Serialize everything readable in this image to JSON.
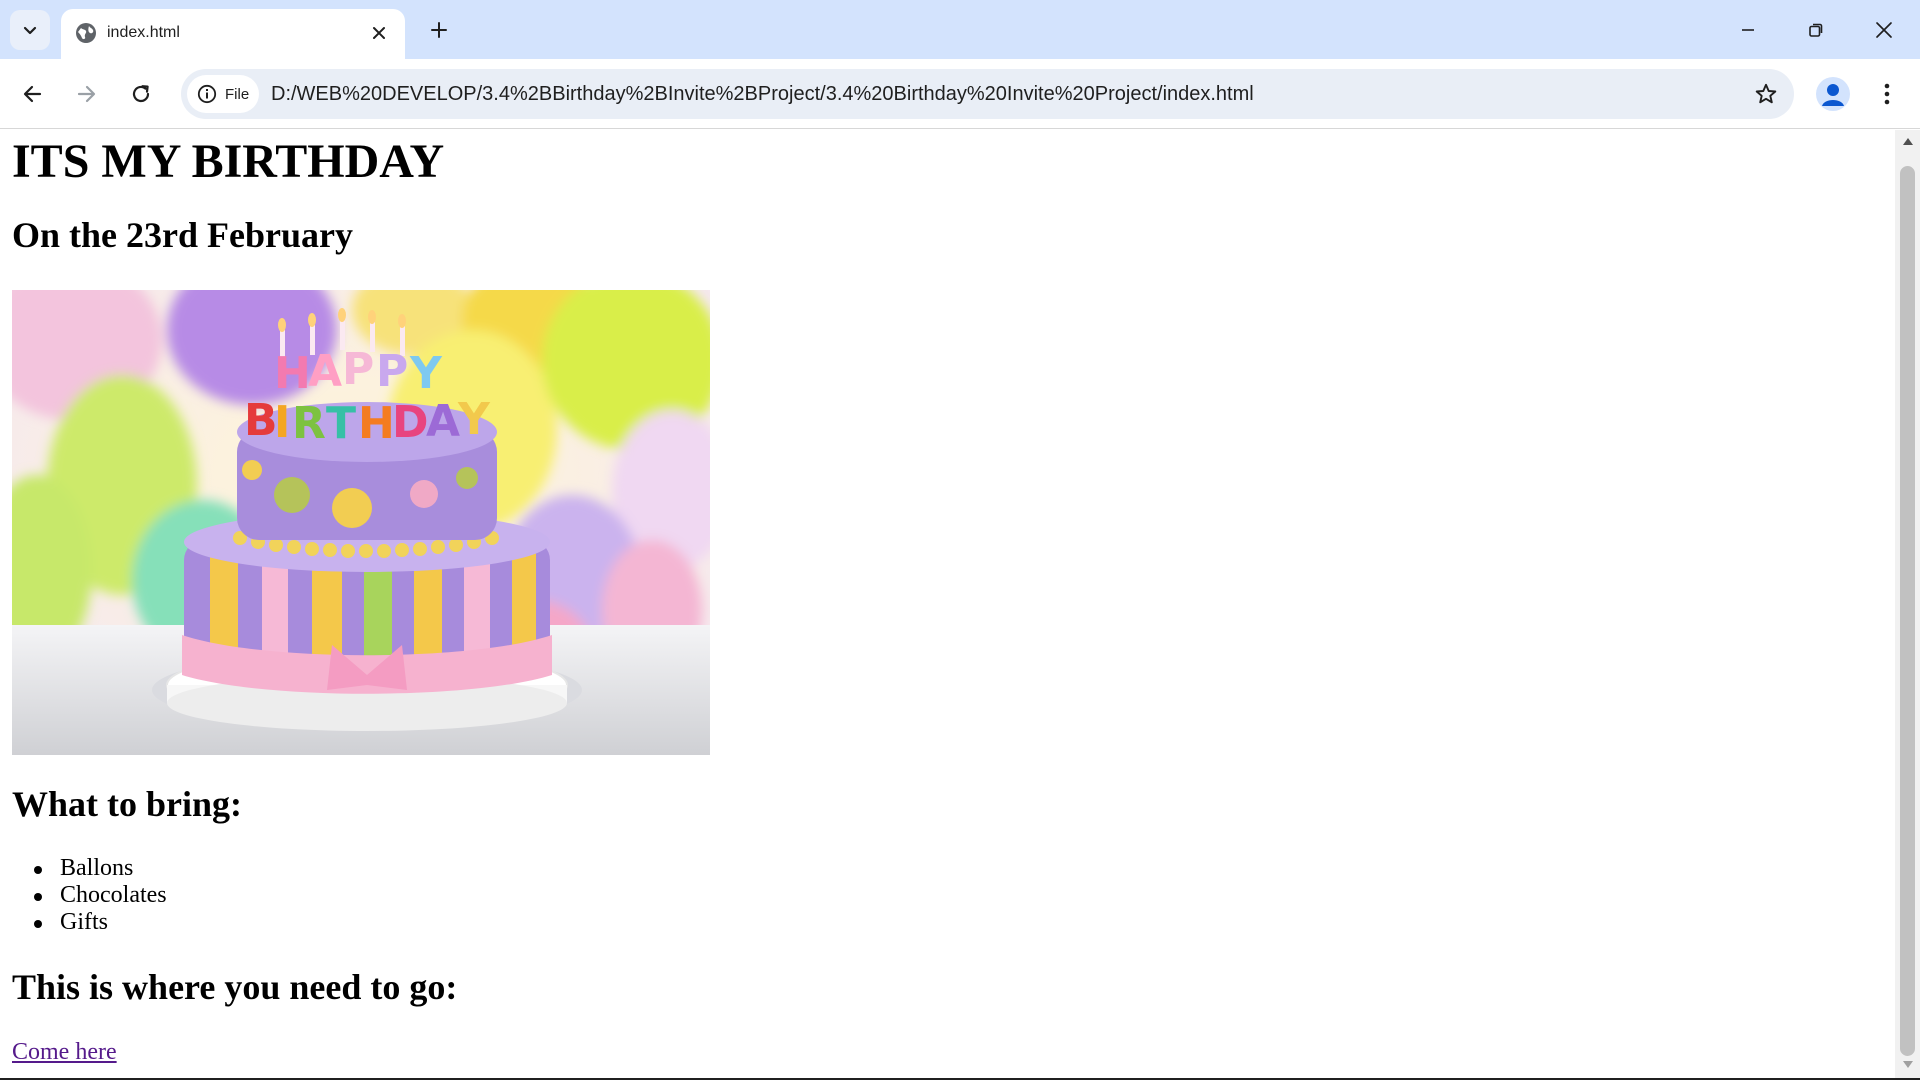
{
  "browser": {
    "tab_title": "index.html",
    "omnibox": {
      "chip_label": "File",
      "url": "D:/WEB%20DEVELOP/3.4%2BBirthday%2BInvite%2BProject/3.4%20Birthday%20Invite%20Project/index.html"
    },
    "colors": {
      "tabstrip": "#d3e3fd",
      "omnibox": "#e9eef6",
      "profile_accent": "#0b57d0"
    }
  },
  "page": {
    "heading": "ITS MY BIRTHDAY",
    "date_heading": "On the 23rd February",
    "cake_image": {
      "candle_letters": "HAPPY BIRTHDAY"
    },
    "bring_heading": "What to bring:",
    "bring_items": [
      "Ballons",
      "Chocolates",
      "Gifts"
    ],
    "location_heading": "This is where you need to go:",
    "location_link": "Come here",
    "link_color": "#551a8b"
  }
}
